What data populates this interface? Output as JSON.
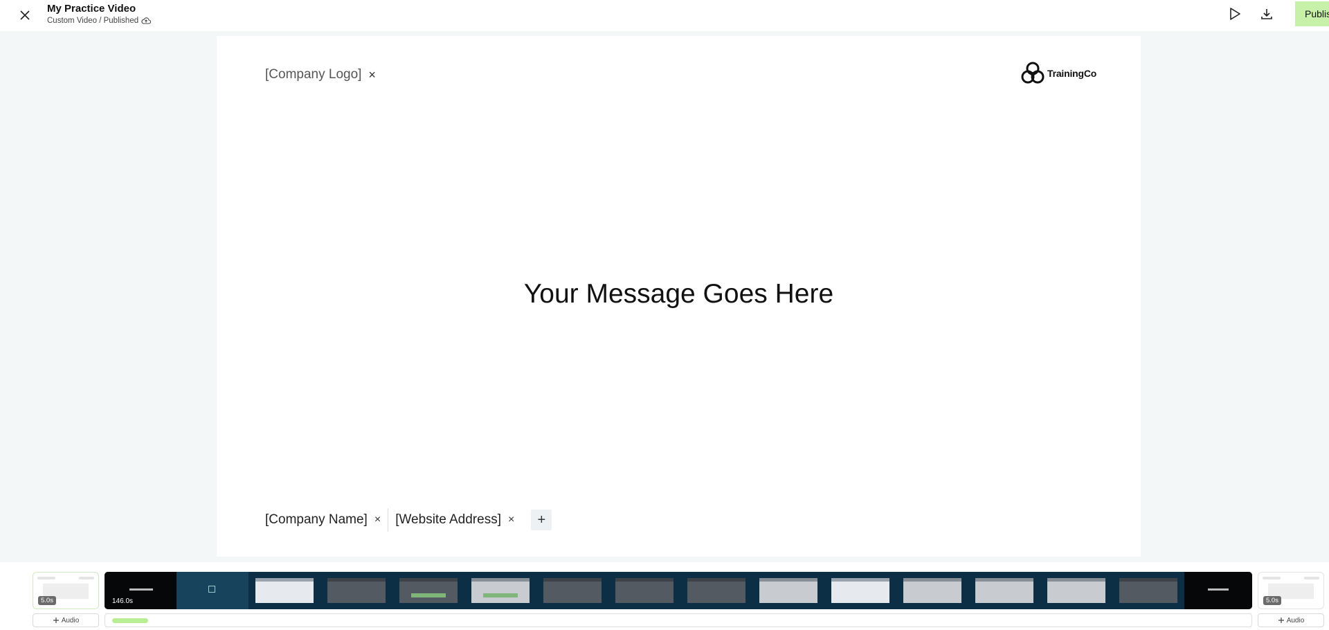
{
  "header": {
    "close_icon": "close-icon",
    "title": "My Practice Video",
    "subtitle": "Custom Video / Published",
    "cloud_icon": "cloud-sync-icon",
    "play_icon": "play-icon",
    "download_icon": "download-icon",
    "publish_label": "Publish",
    "accent_color": "#c7f1a8"
  },
  "slide": {
    "logo_placeholder": "[Company Logo]",
    "remove_symbol": "×",
    "brand_name": "TrainingCo",
    "message": "Your Message Goes Here",
    "footer": {
      "company_name": "[Company Name]",
      "website": "[Website Address]",
      "add_symbol": "+"
    }
  },
  "timeline": {
    "intro_clip": {
      "duration": "5.0s"
    },
    "main_clip": {
      "duration": "146.0s"
    },
    "outro_clip": {
      "duration": "5.0s"
    },
    "audio_label": "Audio",
    "audio_progress": 0.03
  }
}
